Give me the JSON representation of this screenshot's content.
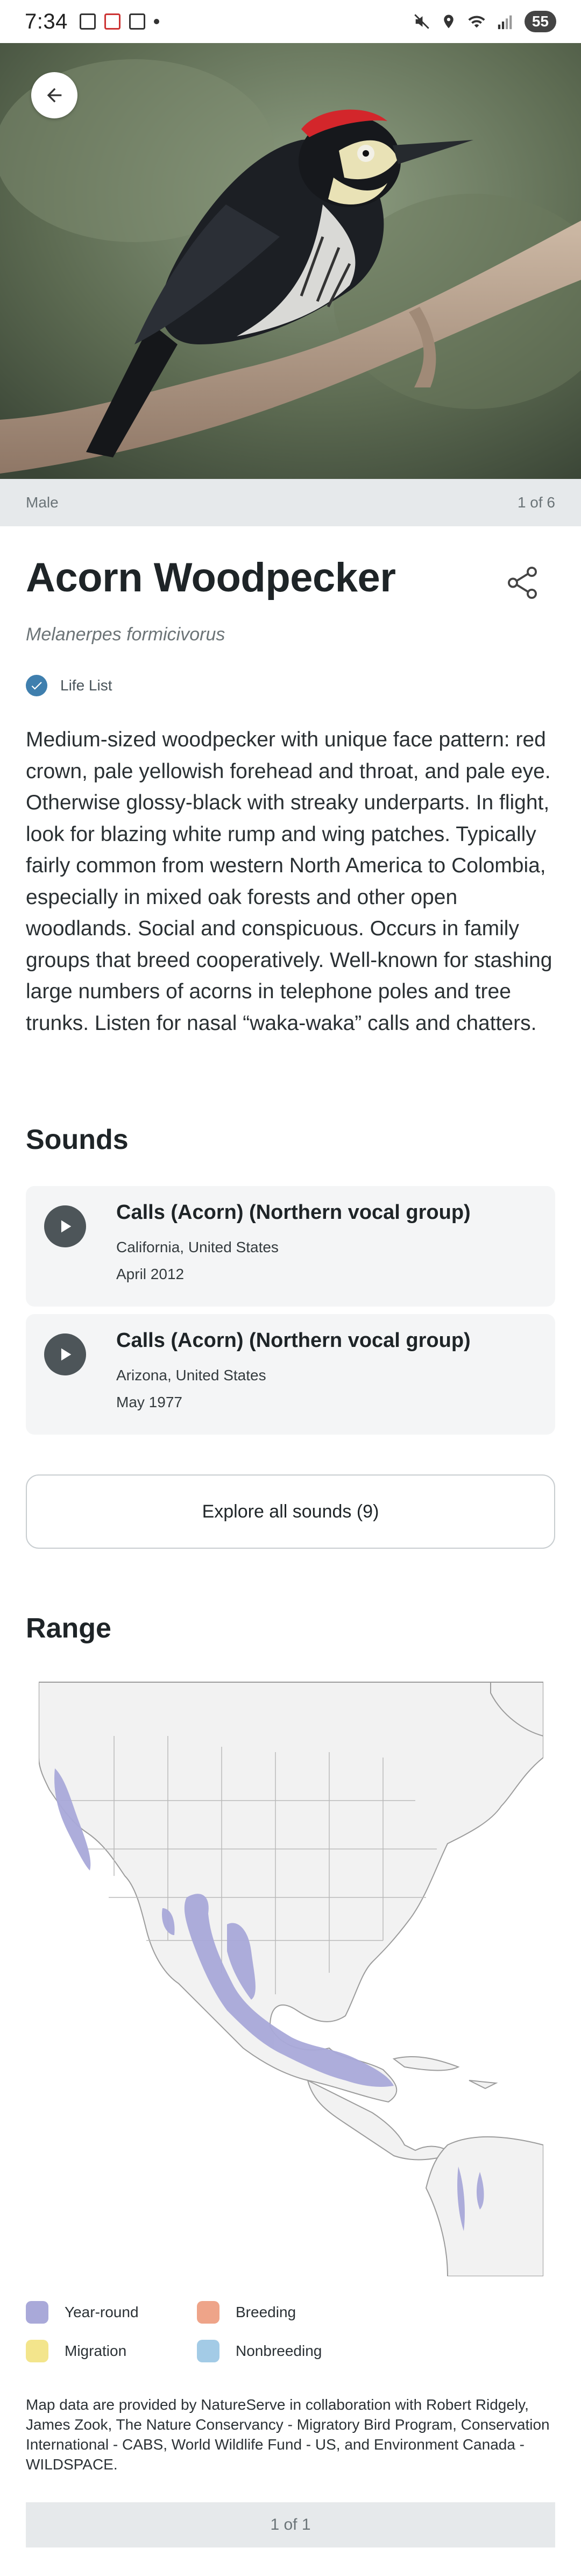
{
  "status_bar": {
    "time": "7:34",
    "battery": "55"
  },
  "hero": {
    "caption_left": "Male",
    "caption_right": "1 of 6"
  },
  "species": {
    "common_name": "Acorn Woodpecker",
    "scientific_name": "Melanerpes formicivorus",
    "life_list_label": "Life List",
    "description": "Medium-sized woodpecker with unique face pattern: red crown, pale yellowish forehead and throat, and pale eye. Otherwise glossy-black with streaky underparts. In flight, look for blazing white rump and wing patches. Typically fairly common from western North America to Colombia, especially in mixed oak forests and other open woodlands. Social and conspicuous. Occurs in family groups that breed cooperatively. Well-known for stashing large numbers of acorns in telephone poles and tree trunks. Listen for nasal “waka-waka” calls and chatters."
  },
  "sounds": {
    "heading": "Sounds",
    "items": [
      {
        "title": "Calls (Acorn) (Northern vocal group)",
        "location": "California, United States",
        "date": "April 2012"
      },
      {
        "title": "Calls (Acorn) (Northern vocal group)",
        "location": "Arizona, United States",
        "date": "May 1977"
      }
    ],
    "explore_label": "Explore all sounds (9)"
  },
  "range": {
    "heading": "Range",
    "legend": [
      {
        "label": "Year-round",
        "color": "#a9a9d9"
      },
      {
        "label": "Breeding",
        "color": "#eea489"
      },
      {
        "label": "Migration",
        "color": "#f3e58c"
      },
      {
        "label": "Nonbreeding",
        "color": "#a3cbe6"
      }
    ],
    "credit": "Map data are provided by NatureServe in collaboration with Robert Ridgely, James Zook, The Nature Conservancy - Migratory Bird Program, Conservation International - CABS, World Wildlife Fund - US, and Environment Canada - WILDSPACE.",
    "pager": "1 of 1"
  },
  "colors": {
    "accent": "#3f7fae",
    "year_round": "#a9a9d9",
    "caption_bg": "#e6e9eb"
  },
  "icons": [
    "back-arrow-icon",
    "share-icon",
    "check-circle-icon",
    "play-icon"
  ]
}
